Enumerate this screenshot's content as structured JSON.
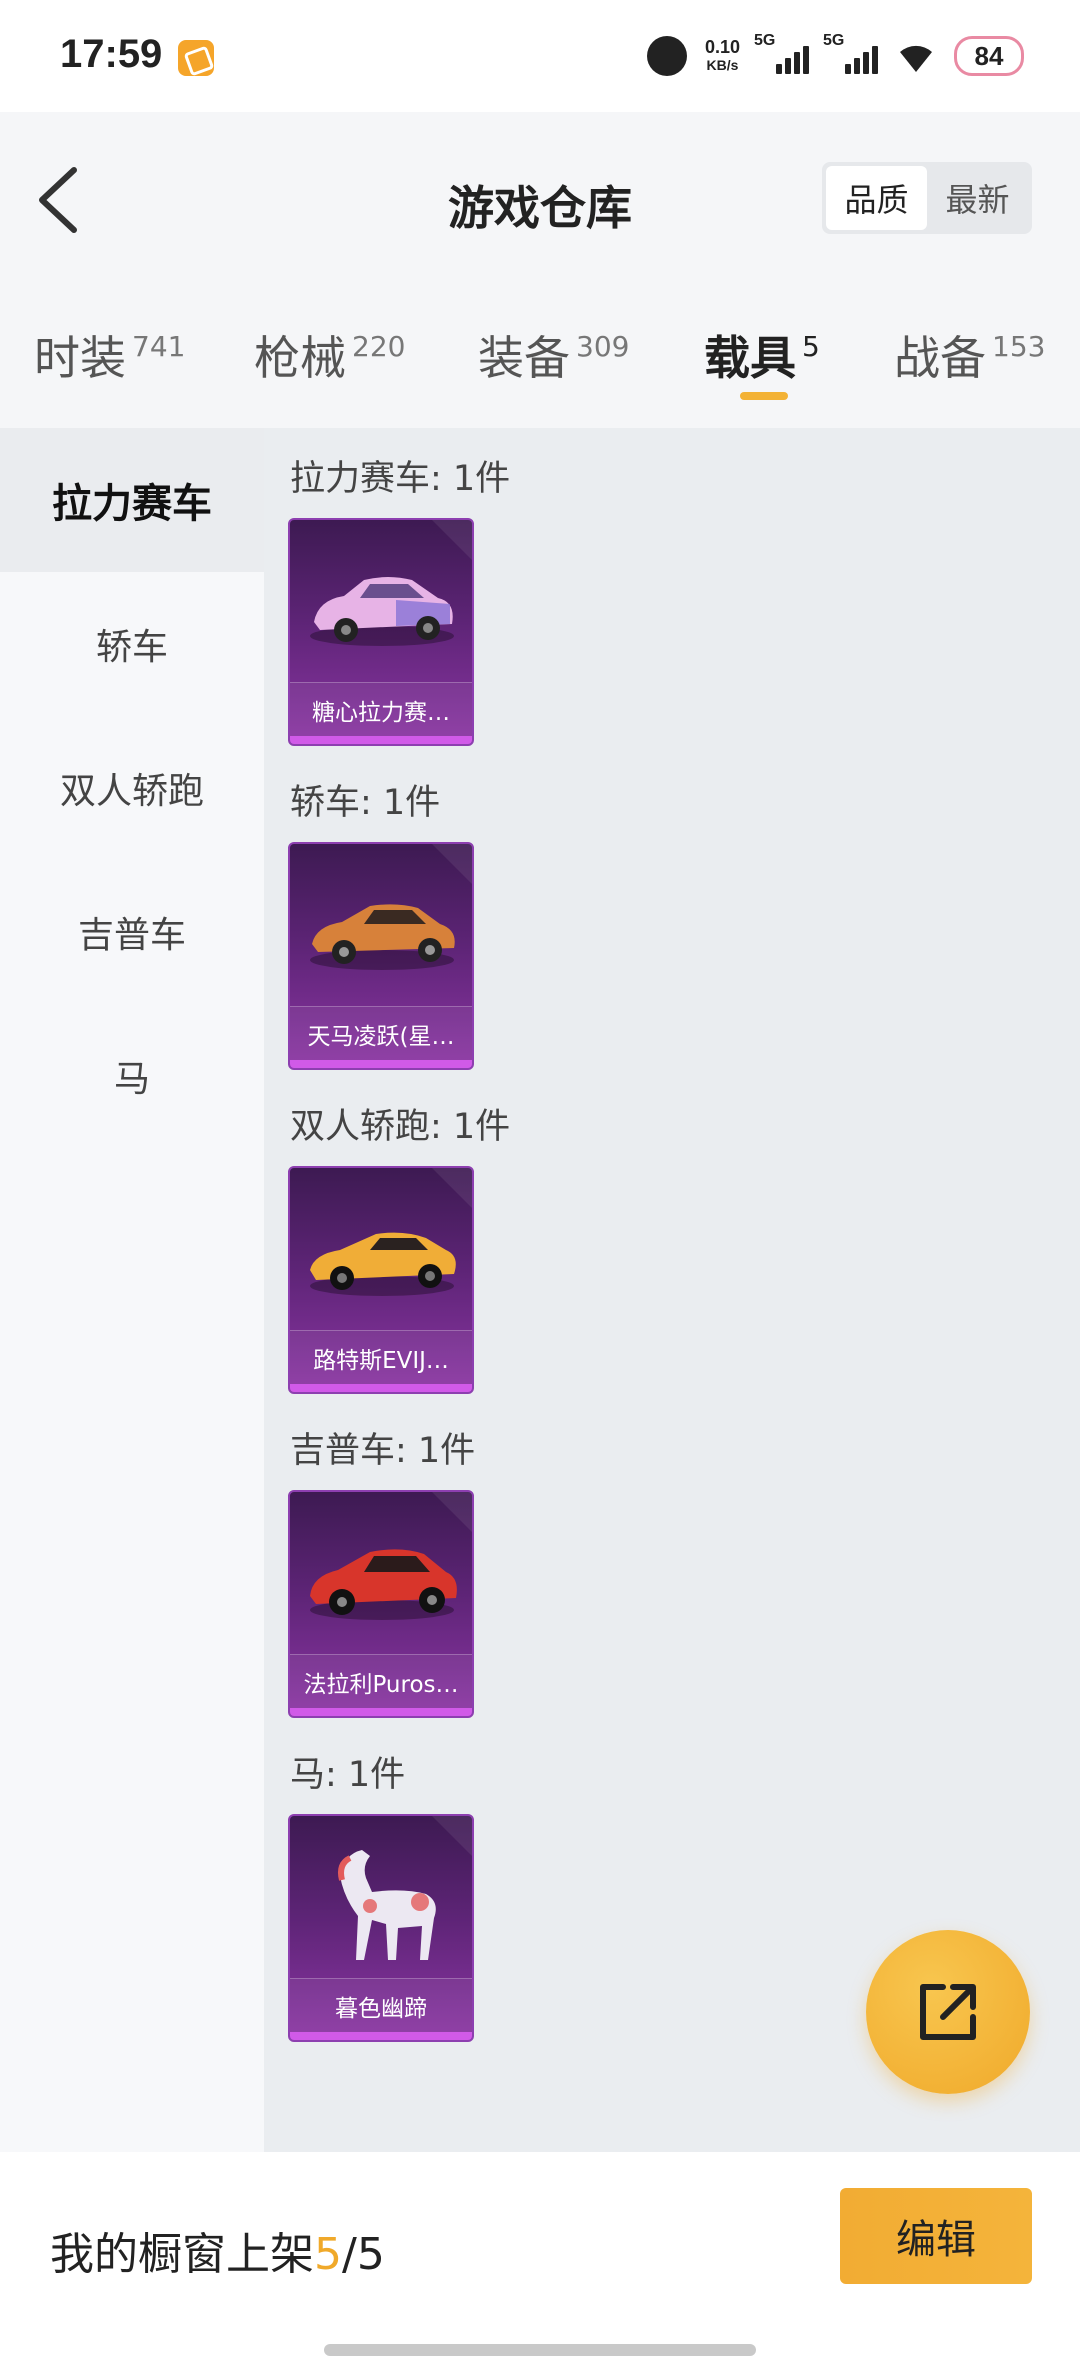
{
  "status_bar": {
    "time": "17:59",
    "net_speed_value": "0.10",
    "net_speed_unit": "KB/s",
    "sim1_label": "5G",
    "sim2_label": "5G",
    "battery": "84"
  },
  "header": {
    "title": "游戏仓库",
    "sort_options": [
      "品质",
      "最新"
    ],
    "sort_selected": "品质"
  },
  "tabs": [
    {
      "label": "时装",
      "count": "741"
    },
    {
      "label": "枪械",
      "count": "220"
    },
    {
      "label": "装备",
      "count": "309"
    },
    {
      "label": "载具",
      "count": "5",
      "active": true
    },
    {
      "label": "战备",
      "count": "153"
    }
  ],
  "sidebar": {
    "items": [
      "拉力赛车",
      "轿车",
      "双人轿跑",
      "吉普车",
      "马"
    ],
    "active": "拉力赛车"
  },
  "sections": [
    {
      "title": "拉力赛车: 1件",
      "item": "糖心拉力赛…",
      "icon": "pink-rally-car-icon",
      "color": "#e5a9e3"
    },
    {
      "title": "轿车: 1件",
      "item": "天马凌跃(星…",
      "icon": "orange-sedan-icon",
      "color": "#d7813a"
    },
    {
      "title": "双人轿跑: 1件",
      "item": "路特斯EVIJ…",
      "icon": "yellow-sports-car-icon",
      "color": "#f0ad37"
    },
    {
      "title": "吉普车: 1件",
      "item": "法拉利Puros…",
      "icon": "red-suv-icon",
      "color": "#d8352b"
    },
    {
      "title": "马: 1件",
      "item": "暮色幽蹄",
      "icon": "horse-icon",
      "color": "#e8e4ee"
    }
  ],
  "bottom": {
    "showcase_prefix": "我的橱窗上架",
    "showcase_current": "5",
    "showcase_sep_total": "/5",
    "edit_label": "编辑"
  }
}
